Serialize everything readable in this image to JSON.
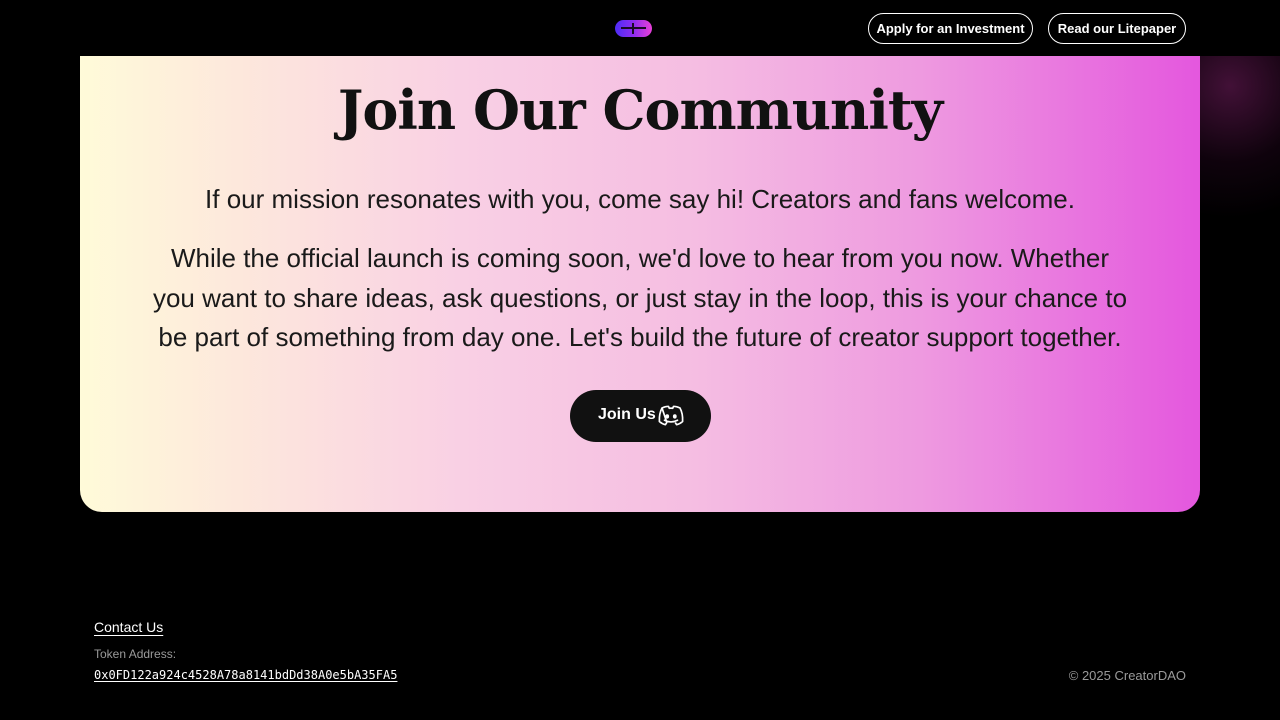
{
  "header": {
    "apply_label": "Apply for an Investment",
    "litepaper_label": "Read our Litepaper"
  },
  "community": {
    "title": "Join Our Community",
    "lead": "If our mission resonates with you, come say hi! Creators and fans welcome.",
    "body": "While the official launch is coming soon, we'd love to hear from you now. Whether you want to share ideas, ask questions, or just stay in the loop, this is your chance to be part of something from day one. Let's build the future of creator support together.",
    "join_label": "Join Us",
    "join_icon": "discord-icon"
  },
  "footer": {
    "contact_label": "Contact Us",
    "token_label": "Token Address:",
    "token_address": "0x0FD122a924c4528A78a8141bdDd38A0e5bA35FA5",
    "copyright": "© 2025 CreatorDAO"
  },
  "colors": {
    "background": "#000000",
    "gradient_start": "#fffbd9",
    "gradient_mid": "#f5bde2",
    "gradient_end": "#e457de",
    "button_dark": "#111111",
    "logo_gradient": [
      "#4d2cf5",
      "#e840d8"
    ]
  }
}
